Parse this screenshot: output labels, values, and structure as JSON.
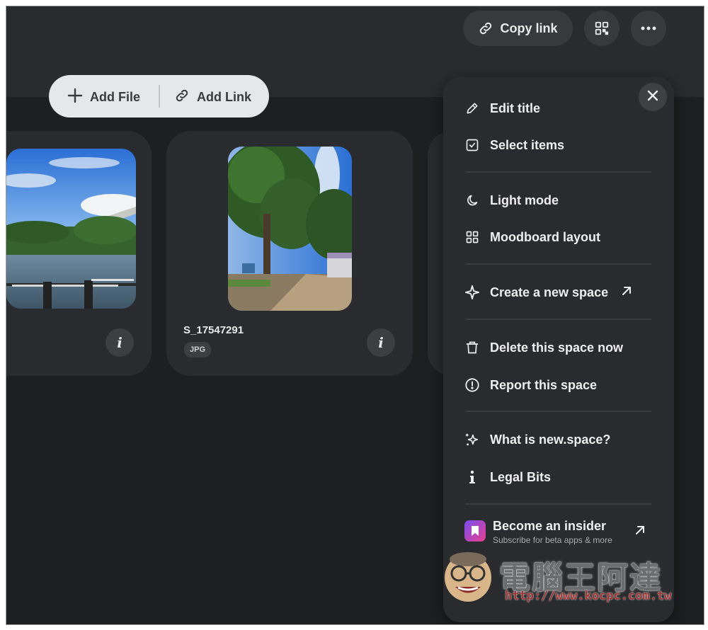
{
  "toolbar": {
    "copy_link_label": "Copy link"
  },
  "add_bar": {
    "add_file_label": "Add File",
    "add_link_label": "Add Link"
  },
  "cards": [
    {
      "name": "",
      "type": ""
    },
    {
      "name": "S_17547291",
      "type": "JPG",
      "info_glyph": "i"
    }
  ],
  "menu": {
    "items": {
      "edit_title": "Edit title",
      "select_items": "Select items",
      "light_mode": "Light mode",
      "moodboard_layout": "Moodboard layout",
      "create_space": "Create a new space",
      "delete_space": "Delete this space now",
      "report_space": "Report this space",
      "what_is": "What is new.space?",
      "legal_bits": "Legal Bits"
    },
    "insider": {
      "title": "Become an insider",
      "subtitle": "Subscribe for beta apps & more"
    }
  },
  "watermark": {
    "text": "電腦王阿達",
    "url": "http://www.kocpc.com.tw"
  },
  "colors": {
    "background": "#1e1f21",
    "panel": "#2a2b2e",
    "accent_insider": "#e8408f"
  }
}
